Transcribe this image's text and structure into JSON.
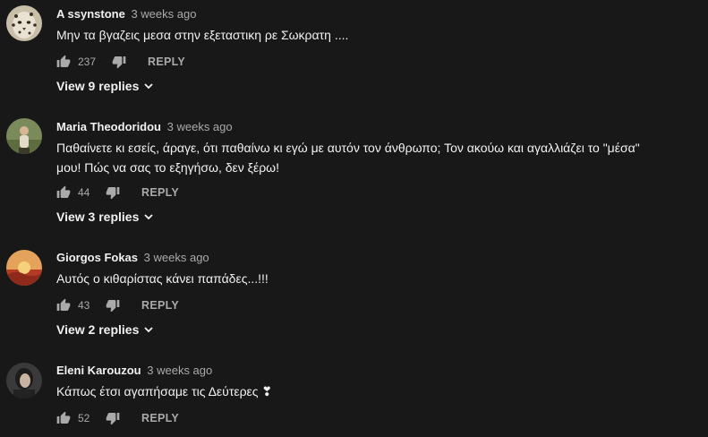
{
  "colors": {
    "background": "#181818",
    "text_primary": "#f1f1f1",
    "text_secondary": "#aaaaaa"
  },
  "comments": [
    {
      "author": "A ssynstone",
      "time": "3 weeks ago",
      "text_lines": [
        "Μην τα βγαζεις μεσα στην εξεταστικη ρε Σωκρατη ...."
      ],
      "likes": "237",
      "reply_label": "REPLY",
      "view_replies": "View 9 replies",
      "avatar_icon": "leopard-avatar"
    },
    {
      "author": "Maria Theodoridou",
      "time": "3 weeks ago",
      "text_lines": [
        "Παθαίνετε κι εσείς, άραγε, ότι παθαίνω κι εγώ με αυτόν τον άνθρωπο;  Τον ακούω και αγαλλιάζει το \"μέσα\"",
        "μου! Πώς να σας το εξηγήσω,  δεν ξέρω!"
      ],
      "likes": "44",
      "reply_label": "REPLY",
      "view_replies": "View 3 replies",
      "avatar_icon": "person-outdoor-avatar"
    },
    {
      "author": "Giorgos Fokas",
      "time": "3 weeks ago",
      "text_lines": [
        "Αυτός ο κιθαρίστας κάνει παπάδες...!!!"
      ],
      "likes": "43",
      "reply_label": "REPLY",
      "view_replies": "View 2 replies",
      "avatar_icon": "sunset-avatar"
    },
    {
      "author": "Eleni Karouzou",
      "time": "3 weeks ago",
      "text_lines": [
        "Κάπως έτσι αγαπήσαμε τις Δεύτερες ❣"
      ],
      "likes": "52",
      "reply_label": "REPLY",
      "view_replies": "",
      "avatar_icon": "person-portrait-avatar"
    }
  ]
}
